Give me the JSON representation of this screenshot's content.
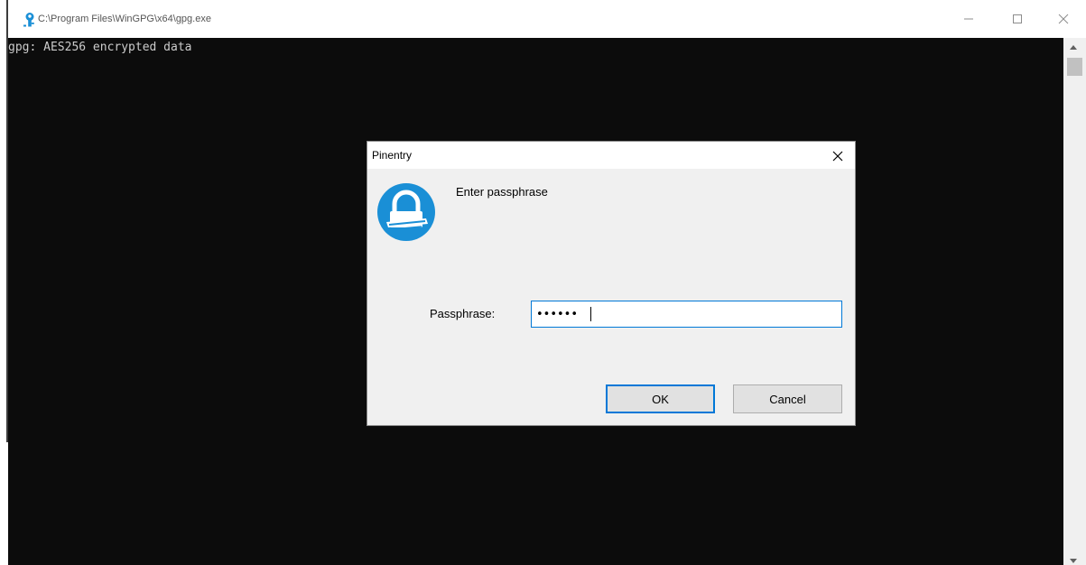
{
  "window": {
    "title": "C:\\Program Files\\WinGPG\\x64\\gpg.exe",
    "icon": "key-icon"
  },
  "console": {
    "lines": [
      "gpg: AES256 encrypted data"
    ]
  },
  "dialog": {
    "title": "Pinentry",
    "icon": "lock-icon",
    "prompt": "Enter passphrase",
    "passphrase_label": "Passphrase:",
    "passphrase_value": "••••••",
    "ok_label": "OK",
    "cancel_label": "Cancel"
  },
  "colors": {
    "console_bg": "#0c0c0c",
    "console_fg": "#cccccc",
    "accent": "#0078d7",
    "icon_blue": "#1a8fd6"
  }
}
